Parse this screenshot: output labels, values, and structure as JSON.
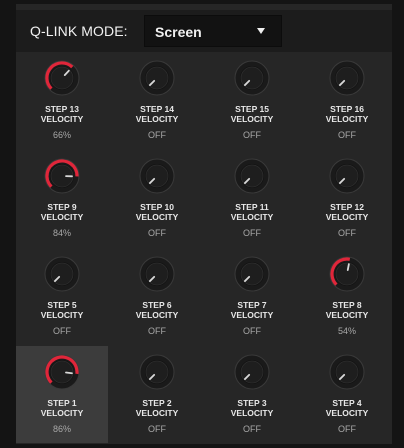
{
  "header": {
    "mode_label": "Q-LINK MODE:",
    "mode_value": "Screen",
    "dropdown_icon": "caret-down-icon"
  },
  "colors": {
    "accent": "#e0263a",
    "knob_body": "#1e1e1e",
    "panel": "#262626"
  },
  "param_label": "VELOCITY",
  "steps": [
    {
      "step": "STEP 13",
      "param": "VELOCITY",
      "value": "66%",
      "level": 0.66
    },
    {
      "step": "STEP 14",
      "param": "VELOCITY",
      "value": "OFF",
      "level": 0
    },
    {
      "step": "STEP 15",
      "param": "VELOCITY",
      "value": "OFF",
      "level": 0
    },
    {
      "step": "STEP 16",
      "param": "VELOCITY",
      "value": "OFF",
      "level": 0
    },
    {
      "step": "STEP 9",
      "param": "VELOCITY",
      "value": "84%",
      "level": 0.84
    },
    {
      "step": "STEP 10",
      "param": "VELOCITY",
      "value": "OFF",
      "level": 0
    },
    {
      "step": "STEP 11",
      "param": "VELOCITY",
      "value": "OFF",
      "level": 0
    },
    {
      "step": "STEP 12",
      "param": "VELOCITY",
      "value": "OFF",
      "level": 0
    },
    {
      "step": "STEP 5",
      "param": "VELOCITY",
      "value": "OFF",
      "level": 0
    },
    {
      "step": "STEP 6",
      "param": "VELOCITY",
      "value": "OFF",
      "level": 0
    },
    {
      "step": "STEP 7",
      "param": "VELOCITY",
      "value": "OFF",
      "level": 0
    },
    {
      "step": "STEP 8",
      "param": "VELOCITY",
      "value": "54%",
      "level": 0.54
    },
    {
      "step": "STEP 1",
      "param": "VELOCITY",
      "value": "86%",
      "level": 0.86,
      "selected": true
    },
    {
      "step": "STEP 2",
      "param": "VELOCITY",
      "value": "OFF",
      "level": 0
    },
    {
      "step": "STEP 3",
      "param": "VELOCITY",
      "value": "OFF",
      "level": 0
    },
    {
      "step": "STEP 4",
      "param": "VELOCITY",
      "value": "OFF",
      "level": 0
    }
  ]
}
